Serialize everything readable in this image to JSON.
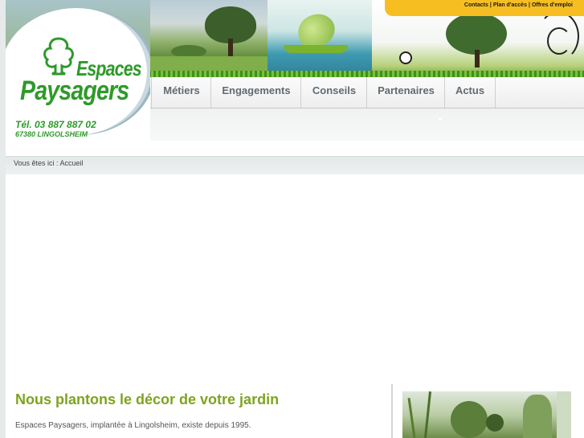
{
  "top_links": [
    "Contacts",
    "Plan d'accès",
    "Offres d'emploi"
  ],
  "logo": {
    "line1": "Espaces",
    "line2": "Paysagers",
    "phone": "Tél. 03 887 887 02",
    "city": "67380 LINGOLSHEIM"
  },
  "nav": {
    "items": [
      "Métiers",
      "Engagements",
      "Conseils",
      "Partenaires",
      "Actus"
    ]
  },
  "breadcrumb": {
    "prefix": "Vous êtes ici : ",
    "current": "Accueil"
  },
  "main": {
    "title": "Nous plantons le décor de votre jardin",
    "intro": "Espaces Paysagers, implantée à Lingolsheim, existe depuis 1995."
  },
  "colors": {
    "brand_green": "#2e9a2a",
    "title_green": "#7ea320",
    "toplinks_yellow": "#f6be21"
  }
}
